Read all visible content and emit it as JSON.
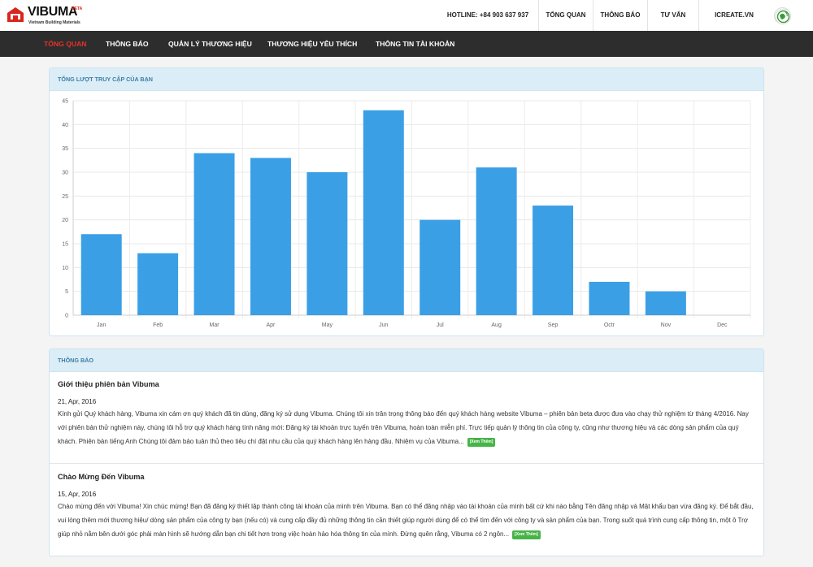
{
  "brand": {
    "name": "VIBUMA",
    "tag": "BETA",
    "subtitle": "Vietnam Building Materials",
    "color": "#d9251d"
  },
  "topnav": {
    "hotline": "HOTLINE: +84 903 637 937",
    "items": [
      "TỔNG QUAN",
      "THÔNG BÁO",
      "TƯ VẤN"
    ],
    "user": "ICREATE.VN"
  },
  "menu": {
    "items": [
      "TỔNG QUAN",
      "THÔNG BÁO",
      "QUẢN LÝ THƯƠNG HIỆU",
      "THƯƠNG HIỆU YÊU THÍCH",
      "THÔNG TIN TÀI KHOẢN"
    ],
    "active_index": 0
  },
  "chart_panel": {
    "title": "TỔNG LƯỢT TRUY CẬP CỦA BẠN"
  },
  "chart_data": {
    "type": "bar",
    "title": "",
    "xlabel": "",
    "ylabel": "",
    "categories": [
      "Jan",
      "Feb",
      "Mar",
      "Apr",
      "May",
      "Jun",
      "Jul",
      "Aug",
      "Sep",
      "Octr",
      "Nov",
      "Dec"
    ],
    "values": [
      17,
      13,
      34,
      33,
      30,
      43,
      20,
      31,
      23,
      7,
      5,
      0
    ],
    "ylim": [
      0,
      45
    ],
    "yticks": [
      0,
      5,
      10,
      15,
      20,
      25,
      30,
      35,
      40,
      45
    ],
    "grid": true,
    "bar_color": "#3b9fe6"
  },
  "notice_panel": {
    "title": "THÔNG BÁO",
    "more_label": "[Xem Thêm]",
    "items": [
      {
        "title": "Giới thiệu phiên bản Vibuma",
        "date": "21, Apr, 2016",
        "body": "Kính gửi Quý khách hàng,   Vibuma xin cám ơn quý khách đã tin dùng, đăng ký sử dụng Vibuma. Chúng tôi xin trân trọng thông báo đến quý khách hàng website Vibuma – phiên bản beta được đưa vào chạy thử nghiệm từ tháng 4/2016. Nay với phiên bản thử nghiệm này, chúng tôi hỗ trợ quý khách hàng tính năng mới: Đăng ký tài khoản trực tuyến trên Vibuma, hoàn toàn miễn phí. Trực tiếp quản lý thông tin của công ty, cũng như thương hiệu và các dòng sản phẩm của quý khách.  Phiên bản tiếng Anh Chúng tôi đảm bảo tuân thủ theo tiêu chí đặt nhu cầu của quý khách hàng lên hàng đầu. Nhiệm vụ của Vibuma..."
      },
      {
        "title": "Chào Mừng Đến Vibuma",
        "date": "15, Apr, 2016",
        "body": "Chào mừng đến với Vibuma!   Xin chúc mừng! Bạn đã đăng ký thiết lập thành công tài khoản của mình trên Vibuma. Bạn có thể đăng nhập vào tài khoản của mình bất cứ khi nào bằng Tên đăng nhập và Mật khẩu bạn vừa đăng ký. Để bắt đầu, vui lòng thêm mới thương hiệu/ dòng sản phẩm của công ty bạn (nếu có) và cung cấp đầy đủ những thông tin cần thiết giúp người dùng để có thể tìm đến với công ty và sản phẩm của bạn. Trong suốt quá trình cung cấp thông tin, một ô Trợ giúp nhỏ nằm bên dưới góc phải màn hình sẽ hướng dẫn bạn chi tiết hơn trong việc hoàn hảo hóa thông tin của mình. Đừng quên rằng, Vibuma có 2 ngôn..."
      }
    ]
  }
}
